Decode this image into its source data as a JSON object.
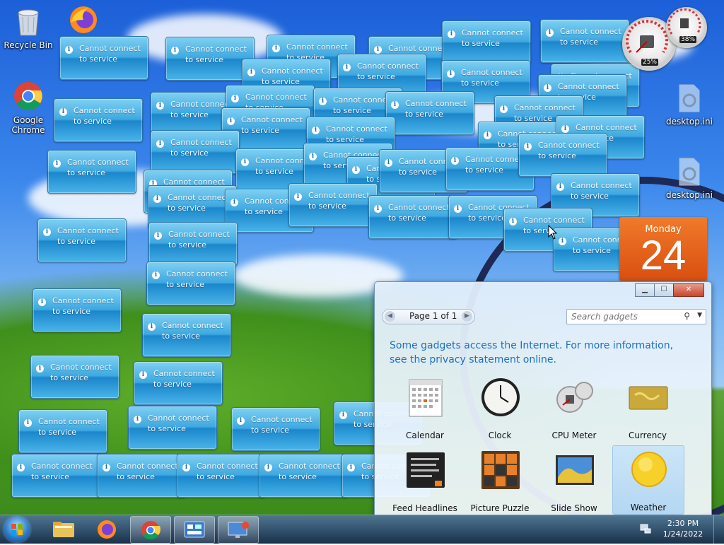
{
  "desktop": {
    "icons": [
      {
        "label": "Recycle Bin",
        "icon": "recycle-bin-icon"
      },
      {
        "label": "",
        "icon": "firefox-icon"
      },
      {
        "label": "Google Chrome",
        "icon": "chrome-icon"
      },
      {
        "label": "desktop.ini",
        "icon": "ini-file-icon"
      },
      {
        "label": "desktop.ini",
        "icon": "ini-file-icon"
      }
    ],
    "tile_text_line1": "Cannot connect",
    "tile_text_line2": "to service"
  },
  "gadgets": {
    "cpu_percent": "25%",
    "memory_percent": "38%",
    "calendar_day": "Monday",
    "calendar_date": "24"
  },
  "gallery": {
    "pager_label": "Page 1 of 1",
    "search_placeholder": "Search gadgets",
    "info_text": "Some gadgets access the Internet.  For more information, see the privacy statement online.",
    "items": [
      {
        "label": "Calendar"
      },
      {
        "label": "Clock"
      },
      {
        "label": "CPU Meter"
      },
      {
        "label": "Currency"
      },
      {
        "label": "Feed Headlines"
      },
      {
        "label": "Picture Puzzle"
      },
      {
        "label": "Slide Show"
      },
      {
        "label": "Weather"
      }
    ],
    "selected": "Weather"
  },
  "taskbar": {
    "time": "2:30 PM",
    "date": "1/24/2022",
    "pinned": [
      "windows-explorer-icon",
      "firefox-icon",
      "chrome-icon",
      "gadgets-icon",
      "remote-desktop-icon"
    ]
  },
  "colors": {
    "tile_blue": "#3ea8e0",
    "info_link": "#1f6fc2",
    "calendar_orange": "#e8621c"
  }
}
